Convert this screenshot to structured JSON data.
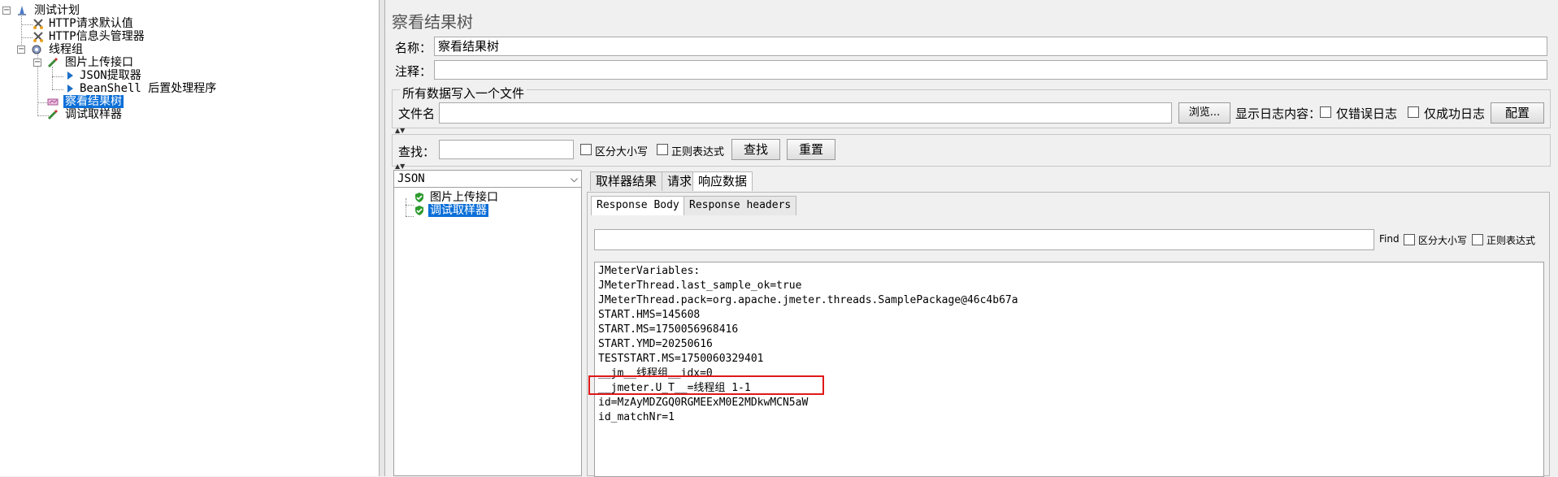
{
  "tree": {
    "nodes": [
      {
        "label": "测试计划",
        "icon": "test-plan-icon"
      },
      {
        "label": "HTTP请求默认值",
        "icon": "config-scissors-icon"
      },
      {
        "label": "HTTP信息头管理器",
        "icon": "config-scissors-icon"
      },
      {
        "label": "线程组",
        "icon": "gear-icon"
      },
      {
        "label": "图片上传接口",
        "icon": "pipette-icon"
      },
      {
        "label": "JSON提取器",
        "icon": "extractor-arrow-icon"
      },
      {
        "label": "BeanShell 后置处理程序",
        "icon": "extractor-arrow-icon"
      },
      {
        "label": "察看结果树",
        "icon": "listener-icon"
      },
      {
        "label": "调试取样器",
        "icon": "pipette-icon"
      }
    ]
  },
  "panel": {
    "title": "察看结果树",
    "name_label": "名称：",
    "name_value": "察看结果树",
    "comment_label": "注释：",
    "comment_value": "",
    "file_group_title": "所有数据写入一个文件",
    "file_label": "文件名",
    "file_value": "",
    "browse_button": "浏览...",
    "log_display_label": "显示日志内容：",
    "errors_only_label": "仅错误日志",
    "success_only_label": "仅成功日志",
    "configure_button": "配置",
    "search_label": "查找：",
    "search_value": "",
    "case_sensitive_label": "区分大小写",
    "regex_label": "正则表达式",
    "find_button": "查找",
    "reset_button": "重置"
  },
  "results": {
    "renderer_selected": "JSON",
    "samples": [
      {
        "label": "图片上传接口",
        "status": "success"
      },
      {
        "label": "调试取样器",
        "status": "success"
      }
    ],
    "tabs": [
      "取样器结果",
      "请求",
      "响应数据"
    ],
    "active_tab": "响应数据",
    "subtabs": [
      "Response Body",
      "Response headers"
    ],
    "active_subtab": "Response Body",
    "find_label": "Find",
    "find_case_label": "区分大小写",
    "find_regex_label": "正则表达式",
    "response_lines": [
      "JMeterVariables:",
      "JMeterThread.last_sample_ok=true",
      "JMeterThread.pack=org.apache.jmeter.threads.SamplePackage@46c4b67a",
      "START.HMS=145608",
      "START.MS=1750056968416",
      "START.YMD=20250616",
      "TESTSTART.MS=1750060329401",
      "__jm__线程组__idx=0",
      "__jmeter.U_T__=线程组 1-1",
      "id=MzAyMDZGQ0RGMEExM0E2MDkwMCN5aW",
      "id_matchNr=1"
    ]
  },
  "colors": {
    "selection": "#0a6fd8",
    "highlight_border": "#e01919",
    "success_shield": "#2e9b2e"
  }
}
